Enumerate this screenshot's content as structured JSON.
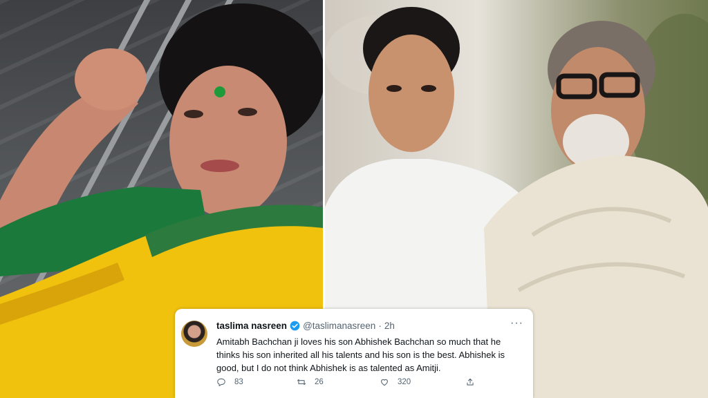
{
  "tweet": {
    "name": "taslima nasreen",
    "handle": "@taslimanasreen",
    "separator": "·",
    "time": "2h",
    "more": "···",
    "text": "Amitabh Bachchan ji loves his son Abhishek Bachchan so much that he thinks his son inherited all his talents and his son is the best.  Abhishek is good, but I do not think Abhishek is as talented as Amitji.",
    "replies": "83",
    "retweets": "26",
    "likes": "320"
  },
  "icons": {
    "verified": "verified-badge-icon",
    "reply": "reply-icon",
    "retweet": "retweet-icon",
    "like": "heart-icon",
    "share": "share-icon"
  },
  "colors": {
    "verified": "#1d9bf0",
    "text": "#0f1419",
    "secondary": "#536471"
  }
}
